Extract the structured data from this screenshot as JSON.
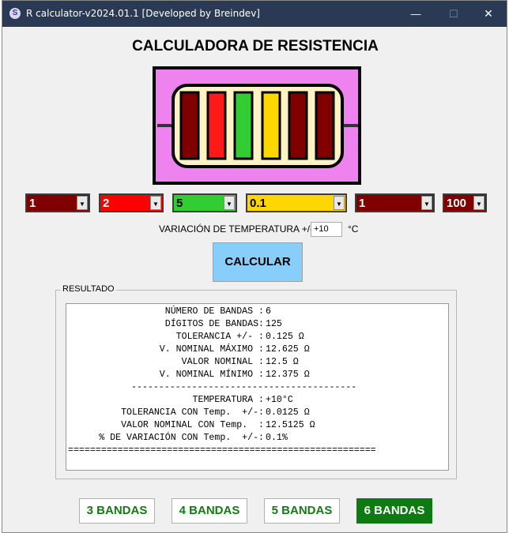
{
  "window": {
    "title": "R calculator-v2024.01.1 [Developed by Breindev]",
    "app_icon": "S",
    "minimize": "—",
    "maximize": "☐",
    "close": "✕"
  },
  "main_title": "CALCULADORA DE RESISTENCIA",
  "resistor": {
    "body_color": "#fff3c4",
    "background_color": "#ee82ee",
    "band_colors": [
      "#800000",
      "#ff1a1a",
      "#32cd32",
      "#ffd700",
      "#800000",
      "#800000"
    ]
  },
  "bands": [
    {
      "value": "1",
      "color": "#800000",
      "text_color": "#ffffff"
    },
    {
      "value": "2",
      "color": "#ff0000",
      "text_color": "#ffffff"
    },
    {
      "value": "5",
      "color": "#32cd32",
      "text_color": "#000000"
    },
    {
      "value": "0.1",
      "color": "#ffd700",
      "text_color": "#000000"
    },
    {
      "value": "1",
      "color": "#800000",
      "text_color": "#ffffff"
    },
    {
      "value": "100",
      "color": "#800000",
      "text_color": "#ffffff"
    }
  ],
  "temperature": {
    "label": "VARIACIÓN DE TEMPERATURA +/- :",
    "value": "+10",
    "unit": "°C"
  },
  "calculate_button": "CALCULAR",
  "result": {
    "legend": "RESULTADO",
    "lines": [
      {
        "label": "NÚMERO DE BANDAS :",
        "value": "6"
      },
      {
        "label": "DÍGITOS DE BANDAS:",
        "value": "125"
      },
      {
        "label": "TOLERANCIA +/- :",
        "value": "0.125 Ω"
      },
      {
        "label": "V. NOMINAL MÁXIMO :",
        "value": "12.625 Ω"
      },
      {
        "label": "VALOR NOMINAL :",
        "value": "12.5 Ω"
      },
      {
        "label": "V. NOMINAL MÍNIMO :",
        "value": "12.375 Ω"
      },
      {
        "label": "",
        "value": "",
        "divider": "-----------------------------------------"
      },
      {
        "label": "TEMPERATURA :",
        "value": "+10°C"
      },
      {
        "label": "TOLERANCIA CON Temp.  +/-:",
        "value": "0.0125 Ω"
      },
      {
        "label": "VALOR NOMINAL CON Temp.  :",
        "value": "12.5125 Ω"
      },
      {
        "label": "% DE VARIACIÓN CON Temp.  +/-:",
        "value": "0.1%"
      },
      {
        "label": "",
        "value": "",
        "divider": "========================================================"
      }
    ]
  },
  "mode_buttons": [
    {
      "label": "3 BANDAS",
      "active": false
    },
    {
      "label": "4 BANDAS",
      "active": false
    },
    {
      "label": "5 BANDAS",
      "active": false
    },
    {
      "label": "6 BANDAS",
      "active": true
    }
  ]
}
